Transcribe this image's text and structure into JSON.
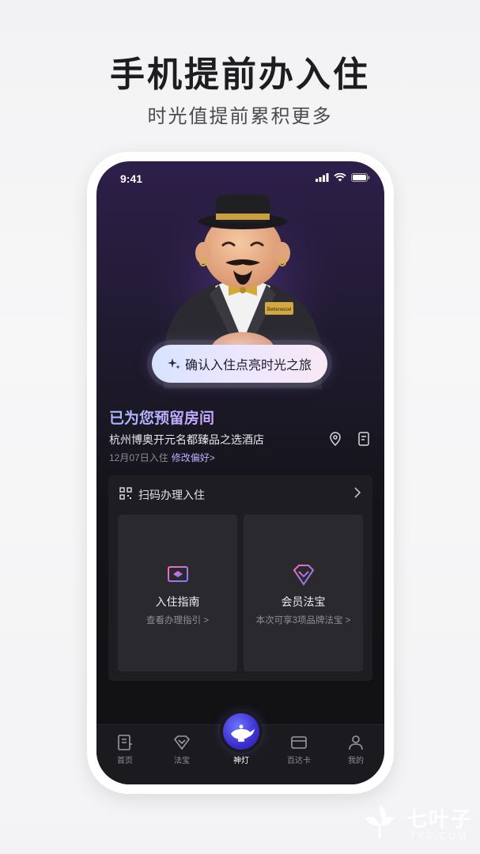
{
  "promo": {
    "headline": "手机提前办入住",
    "subheadline": "时光值提前累积更多"
  },
  "status_bar": {
    "time": "9:41",
    "icons": [
      "signal-icon",
      "wifi-icon",
      "battery-icon"
    ]
  },
  "hero": {
    "name_tag_top": "Betterwood",
    "name_tag_main": "Betterwood",
    "cta_icon": "sparkle-icon",
    "cta_label": "确认入住点亮时光之旅"
  },
  "reservation": {
    "title": "已为您预留房间",
    "hotel_name": "杭州博奥开元名都臻品之选酒店",
    "checkin_date": "12月07日入住",
    "edit_link": "修改偏好>",
    "icons": [
      "location-icon",
      "note-icon"
    ]
  },
  "checkin_card": {
    "scan_label": "扫码办理入住",
    "scan_icon": "qr-scan-icon",
    "tiles": [
      {
        "icon": "guide-icon",
        "title": "入住指南",
        "subtitle": "查看办理指引 >"
      },
      {
        "icon": "diamond-icon",
        "title": "会员法宝",
        "subtitle": "本次可享3项品牌法宝 >"
      }
    ]
  },
  "tab_bar": {
    "tabs": [
      {
        "label": "首页",
        "icon": "home-doc-icon"
      },
      {
        "label": "法宝",
        "icon": "diamond-icon"
      },
      {
        "label": "神灯",
        "icon": "magic-lamp-icon",
        "active": true
      },
      {
        "label": "百达卡",
        "icon": "card-wallet-icon"
      },
      {
        "label": "我的",
        "icon": "user-icon"
      }
    ]
  },
  "watermark": {
    "name": "七叶子",
    "domain": "7YZ.COM"
  },
  "colors": {
    "accent": "#b9b2ff",
    "cta_gradient_start": "#d7e3ff",
    "cta_gradient_end": "#f8e9f4",
    "screen_bg": "#141418"
  }
}
